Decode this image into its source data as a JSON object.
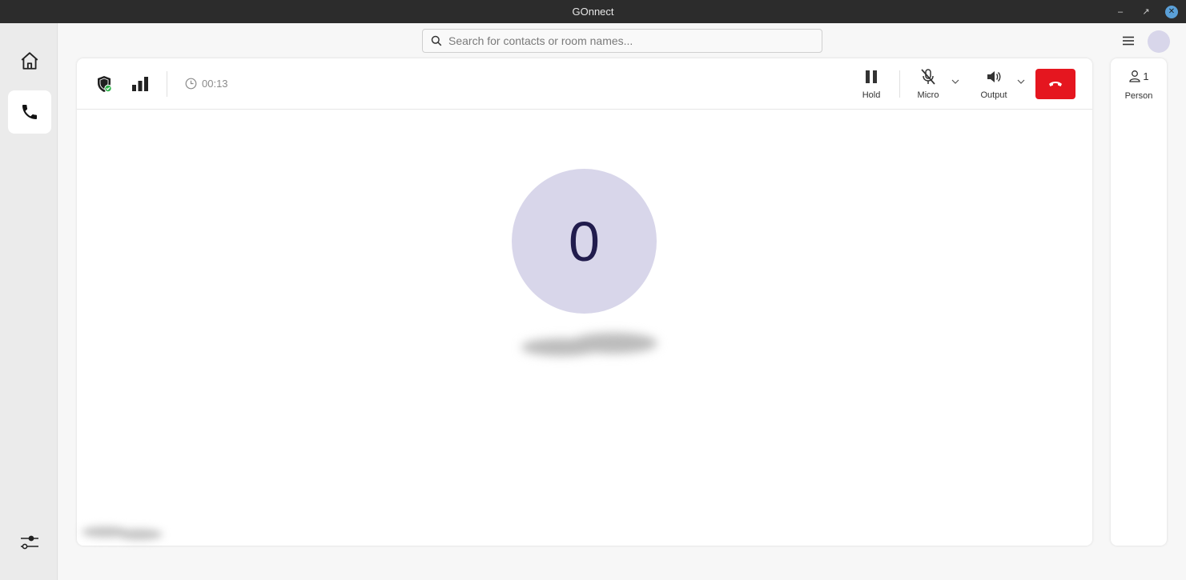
{
  "window": {
    "title": "GOnnect"
  },
  "search": {
    "placeholder": "Search for contacts or room names..."
  },
  "call": {
    "timer": "00:13",
    "avatar_initial": "0",
    "controls": {
      "hold_label": "Hold",
      "micro_label": "Micro",
      "output_label": "Output"
    }
  },
  "participants": {
    "count": "1",
    "label": "Person"
  },
  "colors": {
    "hangup": "#e5161f",
    "avatar_bg": "#d8d6ea",
    "avatar_text": "#211c4d",
    "security_ok": "#2fb24a"
  },
  "icons": {
    "sidebar": [
      "home-icon",
      "phone-icon",
      "sliders-icon"
    ],
    "header": [
      "shield-check-icon",
      "signal-bars-icon",
      "clock-icon"
    ],
    "controls": [
      "pause-icon",
      "mic-off-icon",
      "speaker-icon",
      "hangup-icon"
    ]
  }
}
